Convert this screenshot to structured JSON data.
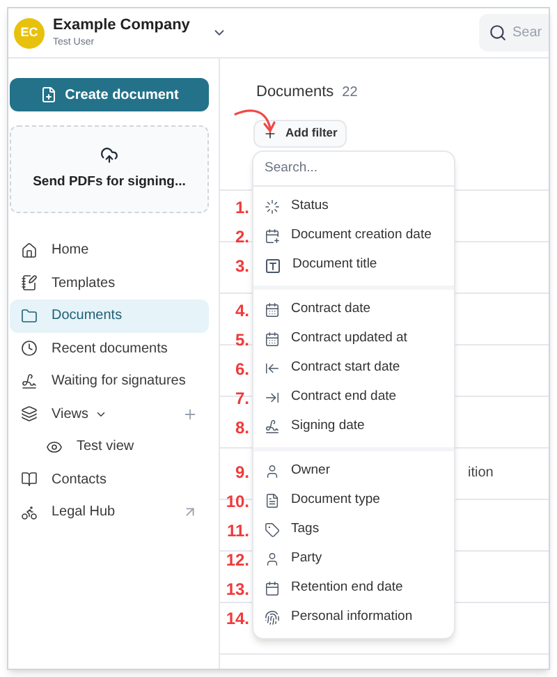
{
  "header": {
    "avatar": "EC",
    "company": "Example Company",
    "user": "Test User",
    "search_placeholder": "Sear"
  },
  "sidebar": {
    "create_button": "Create document",
    "upload": "Send PDFs for signing...",
    "nav": [
      {
        "label": "Home",
        "kind": "page",
        "selected": false
      },
      {
        "label": "Templates",
        "kind": "page",
        "selected": false
      },
      {
        "label": "Documents",
        "kind": "page",
        "selected": true
      },
      {
        "label": "Recent documents",
        "kind": "page",
        "selected": false
      },
      {
        "label": "Waiting for signatures",
        "kind": "page",
        "selected": false
      },
      {
        "label": "Views",
        "kind": "group",
        "selected": false,
        "expanded": true,
        "children": [
          {
            "label": "Test view",
            "selected": false
          }
        ]
      },
      {
        "label": "Contacts",
        "kind": "page",
        "selected": false
      },
      {
        "label": "Legal Hub",
        "kind": "external",
        "selected": false
      }
    ]
  },
  "main": {
    "title": "Documents",
    "count": "22",
    "add_filter": "Add filter",
    "table": {
      "rows": [
        {
          "cell": "ition"
        }
      ]
    },
    "filter_menu": {
      "placeholder": "Search...",
      "groups": [
        [
          {
            "marker": "1.",
            "label": "Status"
          },
          {
            "marker": "2.",
            "label": "Document creation date"
          },
          {
            "marker": "3.",
            "label": "Document title"
          }
        ],
        [
          {
            "marker": "4.",
            "label": "Contract date"
          },
          {
            "marker": "5.",
            "label": "Contract updated at"
          },
          {
            "marker": "6.",
            "label": "Contract start date"
          },
          {
            "marker": "7.",
            "label": "Contract end date"
          },
          {
            "marker": "8.",
            "label": "Signing date"
          }
        ],
        [
          {
            "marker": "9.",
            "label": "Owner"
          },
          {
            "marker": "10.",
            "label": "Document type"
          },
          {
            "marker": "11.",
            "label": "Tags"
          },
          {
            "marker": "12.",
            "label": "Party"
          },
          {
            "marker": "13.",
            "label": "Retention end date"
          },
          {
            "marker": "14.",
            "label": "Personal information"
          }
        ]
      ]
    }
  }
}
